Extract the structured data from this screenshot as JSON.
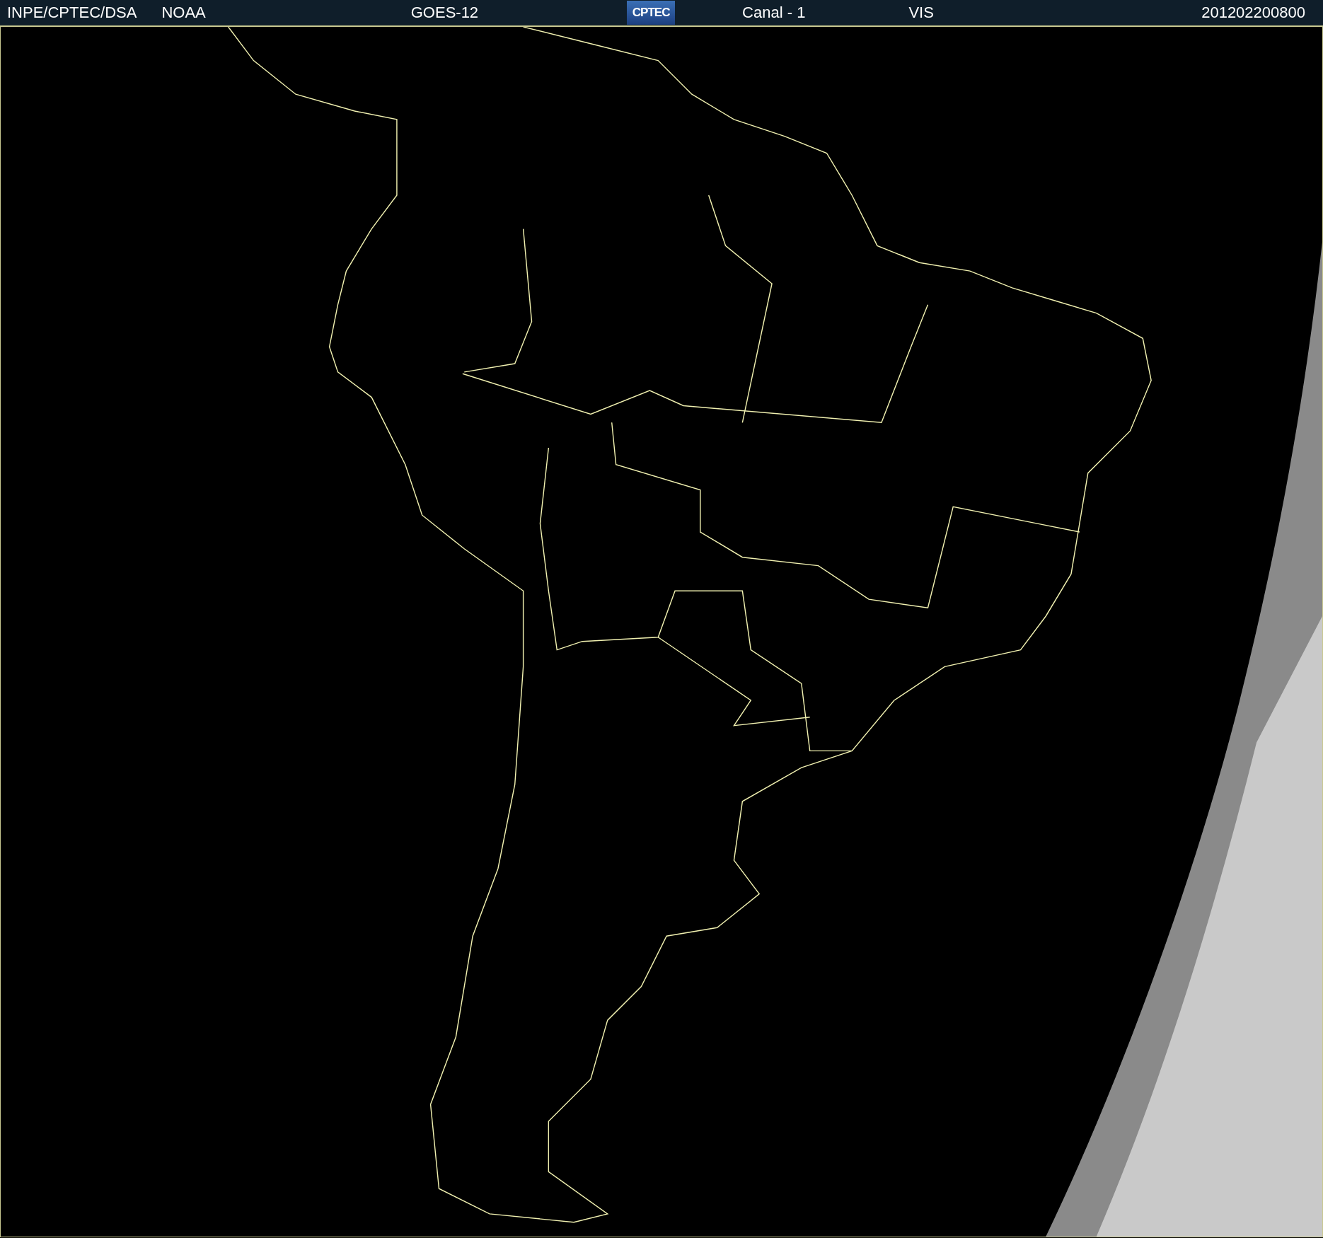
{
  "header": {
    "source": "INPE/CPTEC/DSA",
    "agency": "NOAA",
    "satellite": "GOES-12",
    "logo": "CPTEC",
    "channel": "Canal - 1",
    "band": "VIS",
    "timestamp": "201202200800"
  }
}
